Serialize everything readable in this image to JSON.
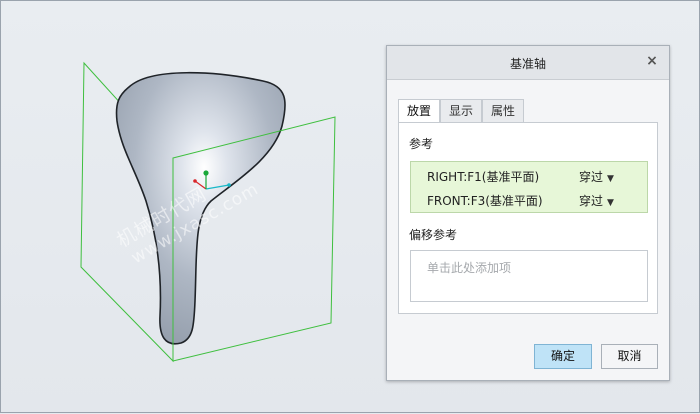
{
  "watermark": {
    "cn": "机械时代网",
    "url": "www.jxasc.com"
  },
  "dialog": {
    "title": "基准轴",
    "close_glyph": "×",
    "tabs": [
      {
        "label": "放置",
        "active": true
      },
      {
        "label": "显示",
        "active": false
      },
      {
        "label": "属性",
        "active": false
      }
    ],
    "references": {
      "label": "参考",
      "rows": [
        {
          "name": "RIGHT:F1(基准平面)",
          "type": "穿过"
        },
        {
          "name": "FRONT:F3(基准平面)",
          "type": "穿过"
        }
      ]
    },
    "offset": {
      "label": "偏移参考",
      "placeholder": "单击此处添加项"
    },
    "buttons": {
      "ok": "确定",
      "cancel": "取消"
    }
  },
  "colors": {
    "selection_green": "#e7f7d8",
    "datum_plane": "#3fbf3f",
    "ok_button": "#bfe3f7",
    "model_gray": "#a7b1be"
  },
  "icons": {
    "close": "close-icon",
    "dropdown": "chevron-down-icon"
  }
}
